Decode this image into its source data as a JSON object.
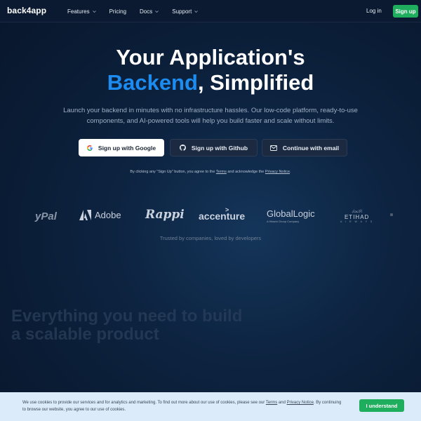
{
  "nav": {
    "logo": "back4app",
    "items": [
      {
        "label": "Features",
        "has_dropdown": true
      },
      {
        "label": "Pricing",
        "has_dropdown": false
      },
      {
        "label": "Docs",
        "has_dropdown": true
      },
      {
        "label": "Support",
        "has_dropdown": true
      }
    ],
    "login": "Log in",
    "signup": "Sign up"
  },
  "hero": {
    "title_line1": "Your Application's",
    "title_highlight": "Backend",
    "title_rest": ", Simplified",
    "description": "Launch your backend in minutes with no infrastructure hassles. Our low-code platform, ready-to-use components, and AI-powered tools will help you build faster and scale without limits.",
    "buttons": {
      "google": "Sign up with Google",
      "github": "Sign up with Github",
      "email": "Continue with email"
    },
    "consent": {
      "prefix": "By clicking any \"Sign Up\" button, you agree to the",
      "terms": "Terms",
      "middle": "and acknowledge the",
      "privacy": "Privacy Notice",
      "suffix": "."
    }
  },
  "logos": {
    "paypal": "yPal",
    "adobe": "Adobe",
    "rappi": "Rappi",
    "accenture": "accenture",
    "accenture_mark": ">",
    "globallogic": "GlobalLogic",
    "globallogic_sub": "A Hitachi Group Company",
    "etihad": "ETIHAD",
    "etihad_top": "الاتحاد",
    "etihad_sub": "A I R W A Y S"
  },
  "trusted": "Trusted by companies, loved by developers",
  "faded_heading": "Everything you need to build a scalable product",
  "cookie": {
    "text_prefix": "We use cookies to provide our services and for analytics and marketing. To find out more about our use of cookies, please see our",
    "terms": "Terms",
    "and": "and",
    "privacy": "Privacy Notice",
    "text_suffix": ". By continuing to browse our website, you agree to our use of cookies.",
    "button": "I understand"
  },
  "colors": {
    "accent_blue": "#1c8cf0",
    "brand_green": "#1fae5d",
    "background": "#0d2340"
  }
}
